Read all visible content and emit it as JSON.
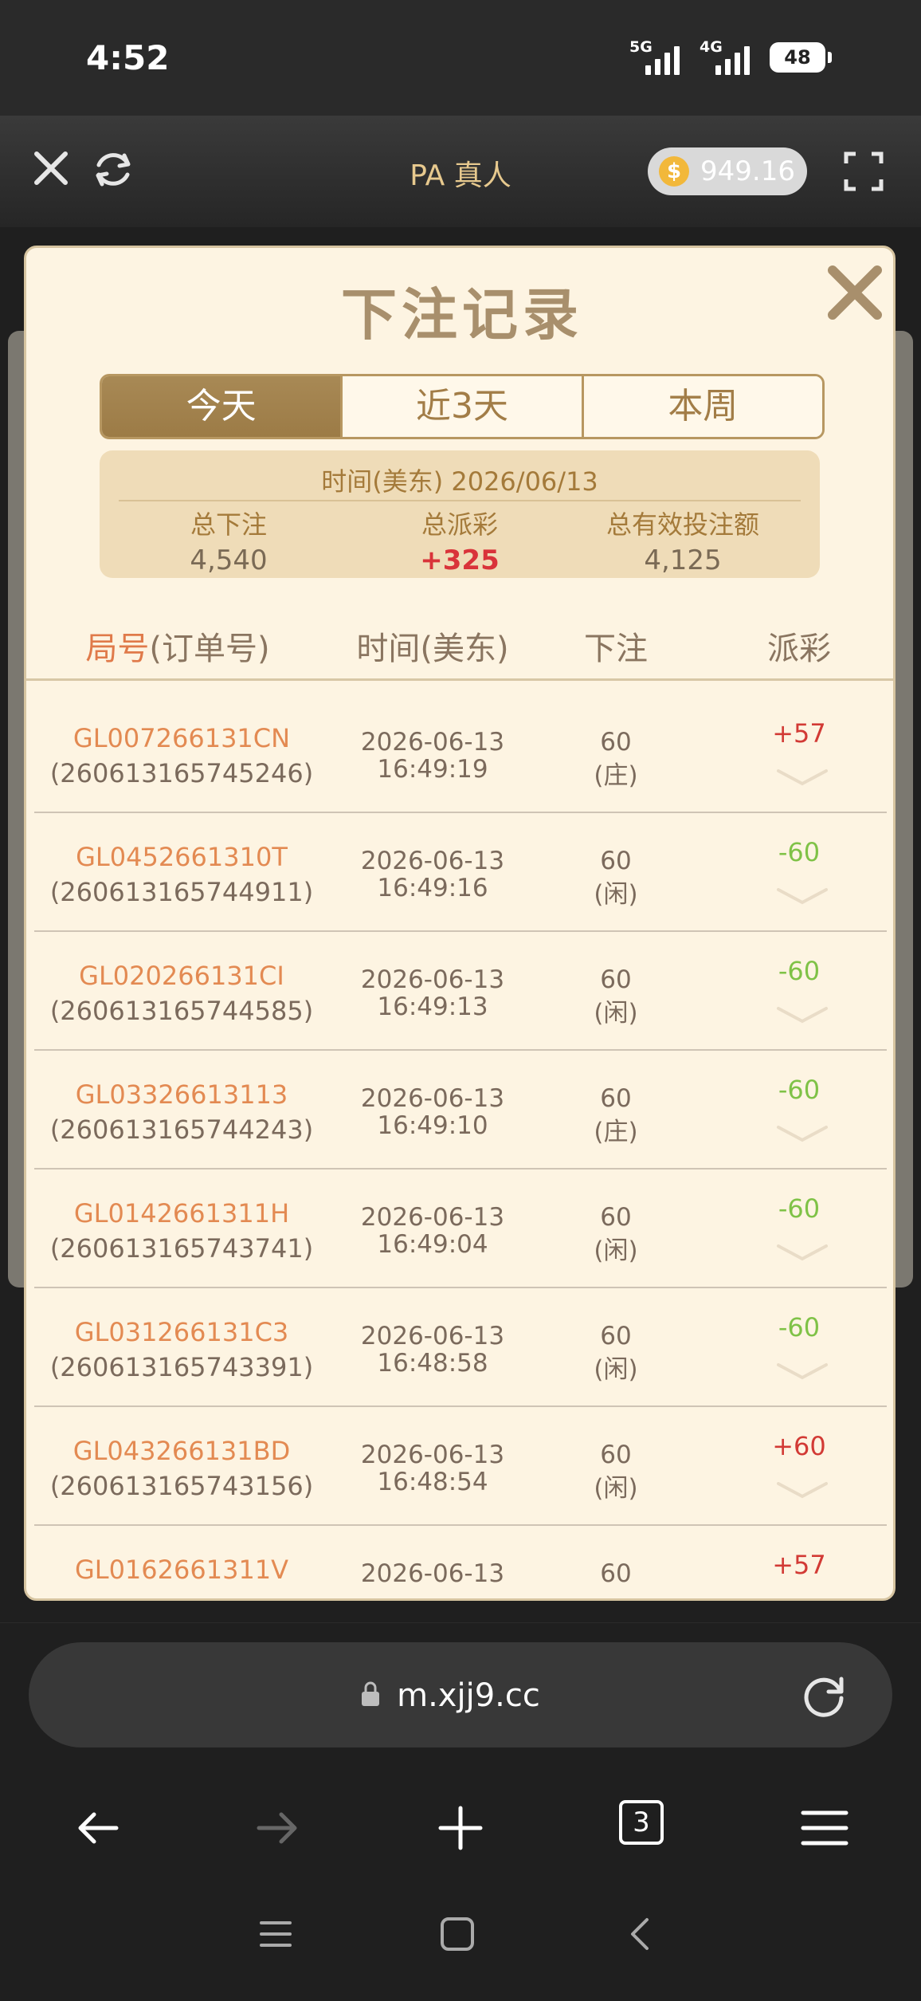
{
  "status_bar": {
    "time": "4:52",
    "signal1": "5G",
    "signal2": "4G",
    "battery": "48"
  },
  "header": {
    "title": "PA 真人",
    "balance": "949.16",
    "coin_symbol": "$",
    "icons": [
      "close-icon",
      "refresh-icon",
      "fullscreen-icon"
    ]
  },
  "modal": {
    "title": "下注记录",
    "tabs": [
      {
        "label": "今天",
        "active": true
      },
      {
        "label": "近3天",
        "active": false
      },
      {
        "label": "本周",
        "active": false
      }
    ],
    "summary": {
      "date_label": "时间(美东) 2026/06/13",
      "total_bet_label": "总下注",
      "total_bet": "4,540",
      "total_payout_label": "总派彩",
      "total_payout": "+325",
      "total_valid_label": "总有效投注额",
      "total_valid": "4,125"
    },
    "columns": {
      "c1a": "局号",
      "c1b": "(订单号)",
      "c2": "时间(美东)",
      "c3": "下注",
      "c4": "派彩"
    },
    "rows": [
      {
        "id": "GL007266131CN",
        "order": "(260613165745246)",
        "date": "2026-06-13",
        "time": "16:49:19",
        "bet": "60",
        "side": "(庄)",
        "payout": "+57",
        "positive": true
      },
      {
        "id": "GL0452661310T",
        "order": "(260613165744911)",
        "date": "2026-06-13",
        "time": "16:49:16",
        "bet": "60",
        "side": "(闲)",
        "payout": "-60",
        "positive": false
      },
      {
        "id": "GL020266131CI",
        "order": "(260613165744585)",
        "date": "2026-06-13",
        "time": "16:49:13",
        "bet": "60",
        "side": "(闲)",
        "payout": "-60",
        "positive": false
      },
      {
        "id": "GL03326613113",
        "order": "(260613165744243)",
        "date": "2026-06-13",
        "time": "16:49:10",
        "bet": "60",
        "side": "(庄)",
        "payout": "-60",
        "positive": false
      },
      {
        "id": "GL0142661311H",
        "order": "(260613165743741)",
        "date": "2026-06-13",
        "time": "16:49:04",
        "bet": "60",
        "side": "(闲)",
        "payout": "-60",
        "positive": false
      },
      {
        "id": "GL031266131C3",
        "order": "(260613165743391)",
        "date": "2026-06-13",
        "time": "16:48:58",
        "bet": "60",
        "side": "(闲)",
        "payout": "-60",
        "positive": false
      },
      {
        "id": "GL043266131BD",
        "order": "(260613165743156)",
        "date": "2026-06-13",
        "time": "16:48:54",
        "bet": "60",
        "side": "(闲)",
        "payout": "+60",
        "positive": true
      }
    ],
    "partial_row": {
      "id": "GL0162661311V",
      "date": "2026-06-13",
      "bet": "60",
      "payout": "+57"
    }
  },
  "browser": {
    "url": "m.xjj9.cc",
    "tab_count": "3"
  }
}
